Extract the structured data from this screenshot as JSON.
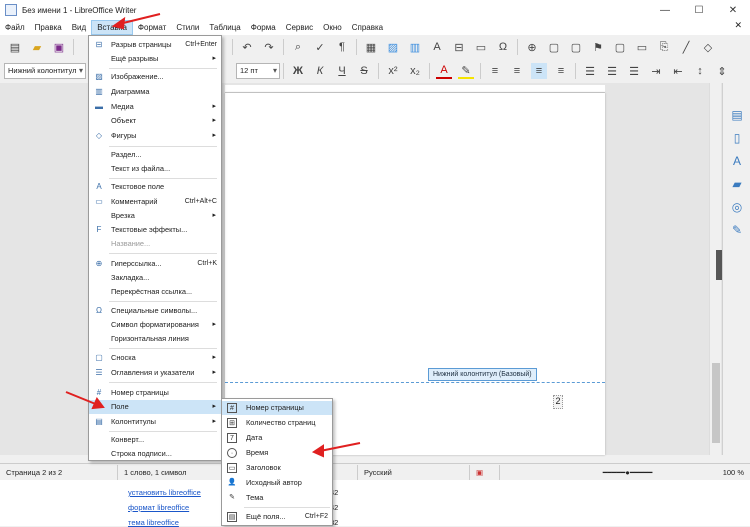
{
  "window": {
    "title": "Без имени 1 - LibreOffice Writer",
    "min": "—",
    "max": "☐",
    "close": "✕"
  },
  "menubar": {
    "items": [
      "Файл",
      "Правка",
      "Вид",
      "Вставка",
      "Формат",
      "Стили",
      "Таблица",
      "Форма",
      "Сервис",
      "Окно",
      "Справка"
    ],
    "active": "Вставка",
    "close_doc": "✕"
  },
  "toolbar2": {
    "para_style": "Нижний колонтитул",
    "font_size": "12 пт",
    "bold": "Ж",
    "italic": "К",
    "underline": "Ч",
    "strike": "S",
    "superscript": "x²",
    "subscript": "x₂",
    "font_color": "A"
  },
  "footer": {
    "tag": "Нижний колонтитул (Базовый)",
    "page_field": "2"
  },
  "insert_menu": {
    "items": [
      {
        "label": "Разрыв страницы",
        "shortcut": "Ctrl+Enter",
        "icon": "page-break-icon"
      },
      {
        "label": "Ещё разрывы",
        "submenu": true
      },
      {
        "label": "Изображение...",
        "icon": "image-icon"
      },
      {
        "label": "Диаграмма",
        "icon": "chart-icon"
      },
      {
        "label": "Медиа",
        "submenu": true,
        "icon": "media-icon"
      },
      {
        "label": "Объект",
        "submenu": true
      },
      {
        "label": "Фигуры",
        "submenu": true,
        "icon": "shapes-icon"
      },
      {
        "label": "Раздел..."
      },
      {
        "label": "Текст из файла..."
      },
      {
        "label": "Текстовое поле",
        "icon": "textbox-icon"
      },
      {
        "label": "Комментарий",
        "shortcut": "Ctrl+Alt+C",
        "icon": "comment-icon"
      },
      {
        "label": "Врезка",
        "submenu": true
      },
      {
        "label": "Текстовые эффекты...",
        "icon": "fontwork-icon"
      },
      {
        "label": "Название...",
        "disabled": true
      },
      {
        "label": "Гиперссылка...",
        "shortcut": "Ctrl+K",
        "icon": "hyperlink-icon"
      },
      {
        "label": "Закладка..."
      },
      {
        "label": "Перекрёстная ссылка..."
      },
      {
        "label": "Специальные символы...",
        "icon": "omega-icon"
      },
      {
        "label": "Символ форматирования",
        "submenu": true
      },
      {
        "label": "Горизонтальная линия"
      },
      {
        "label": "Сноска",
        "submenu": true,
        "icon": "footnote-icon"
      },
      {
        "label": "Оглавления и указатели",
        "submenu": true,
        "icon": "toc-icon"
      },
      {
        "label": "Номер страницы",
        "icon": "page-number-icon"
      },
      {
        "label": "Поле",
        "submenu": true,
        "highlighted": true
      },
      {
        "label": "Колонтитулы",
        "submenu": true,
        "icon": "header-footer-icon"
      },
      {
        "label": "Конверт..."
      },
      {
        "label": "Строка подписи..."
      }
    ]
  },
  "field_submenu": {
    "items": [
      {
        "label": "Номер страницы",
        "icon": "page-number-icon",
        "highlighted": true
      },
      {
        "label": "Количество страниц",
        "icon": "page-count-icon"
      },
      {
        "label": "Дата",
        "icon": "date-icon"
      },
      {
        "label": "Время",
        "icon": "time-icon"
      },
      {
        "label": "Заголовок",
        "icon": "title-icon"
      },
      {
        "label": "Исходный автор",
        "icon": "author-icon"
      },
      {
        "label": "Тема",
        "icon": "subject-icon"
      },
      {
        "label": "Ещё поля...",
        "shortcut": "Ctrl+F2",
        "icon": "more-fields-icon"
      }
    ]
  },
  "status": {
    "page": "Страница 2 из 2",
    "words": "1 слово, 1 символ",
    "lang": "Русский",
    "zoom": "100 %"
  },
  "below_links": [
    "установить libreoffice",
    "формат libreoffice",
    "тема libreoffice"
  ],
  "below_numbers": [
    "42",
    "42",
    "82"
  ]
}
